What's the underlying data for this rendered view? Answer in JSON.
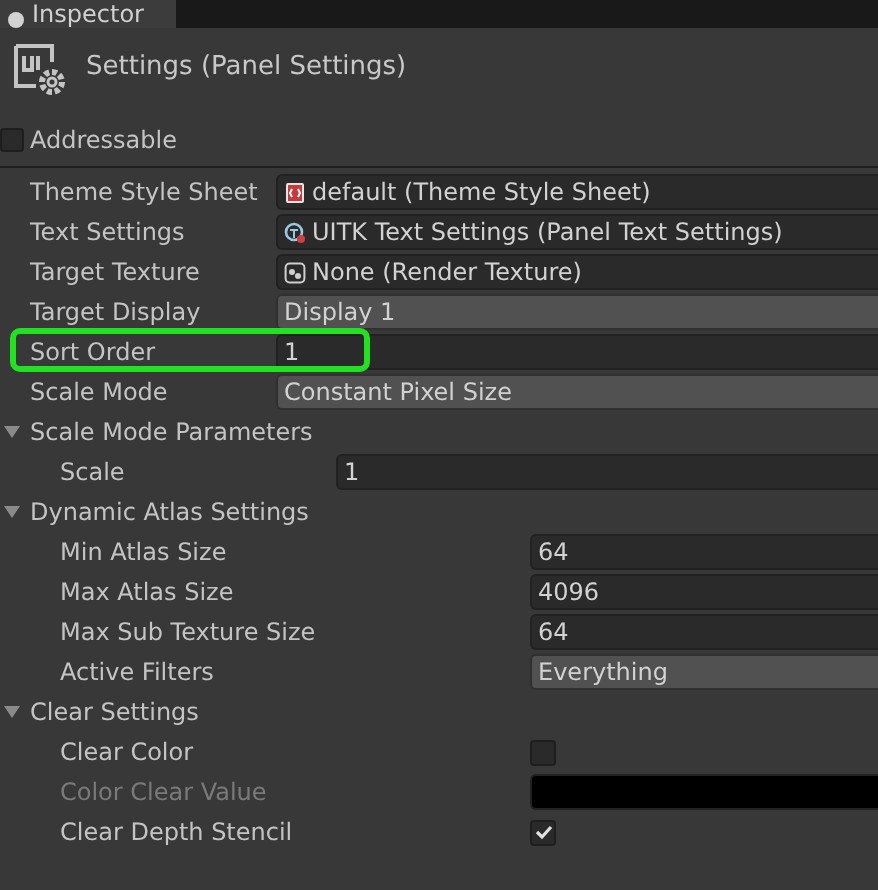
{
  "tab": {
    "label": "Inspector",
    "selected": true
  },
  "header": {
    "title": "Settings (Panel Settings)"
  },
  "addressable": {
    "label": "Addressable",
    "checked": false
  },
  "rows": [
    {
      "kind": "object",
      "label": "Theme Style Sheet",
      "value": "default (Theme Style Sheet)"
    },
    {
      "kind": "object",
      "label": "Text Settings",
      "value": "UITK Text Settings (Panel Text Settings)"
    },
    {
      "kind": "object",
      "label": "Target Texture",
      "value": "None (Render Texture)"
    },
    {
      "kind": "dropdown",
      "label": "Target Display",
      "value": "Display 1"
    },
    {
      "kind": "number",
      "label": "Sort Order",
      "value": "1",
      "highlighted": true
    },
    {
      "kind": "dropdown",
      "label": "Scale Mode",
      "value": "Constant Pixel Size"
    }
  ],
  "sections": [
    {
      "label": "Scale Mode Parameters",
      "expanded": true,
      "children": [
        {
          "kind": "number",
          "label": "Scale",
          "value": "1"
        }
      ]
    },
    {
      "label": "Dynamic Atlas Settings",
      "expanded": true,
      "children": [
        {
          "kind": "number",
          "label": "Min Atlas Size",
          "value": "64"
        },
        {
          "kind": "number",
          "label": "Max Atlas Size",
          "value": "4096"
        },
        {
          "kind": "number",
          "label": "Max Sub Texture Size",
          "value": "64"
        },
        {
          "kind": "dropdown",
          "label": "Active Filters",
          "value": "Everything"
        }
      ]
    },
    {
      "label": "Clear Settings",
      "expanded": true,
      "children": [
        {
          "kind": "checkbox",
          "label": "Clear Color",
          "checked": false
        },
        {
          "kind": "color",
          "label": "Color Clear Value",
          "color": "#000000",
          "disabled": true
        },
        {
          "kind": "checkbox",
          "label": "Clear Depth Stencil",
          "checked": true
        }
      ]
    }
  ]
}
